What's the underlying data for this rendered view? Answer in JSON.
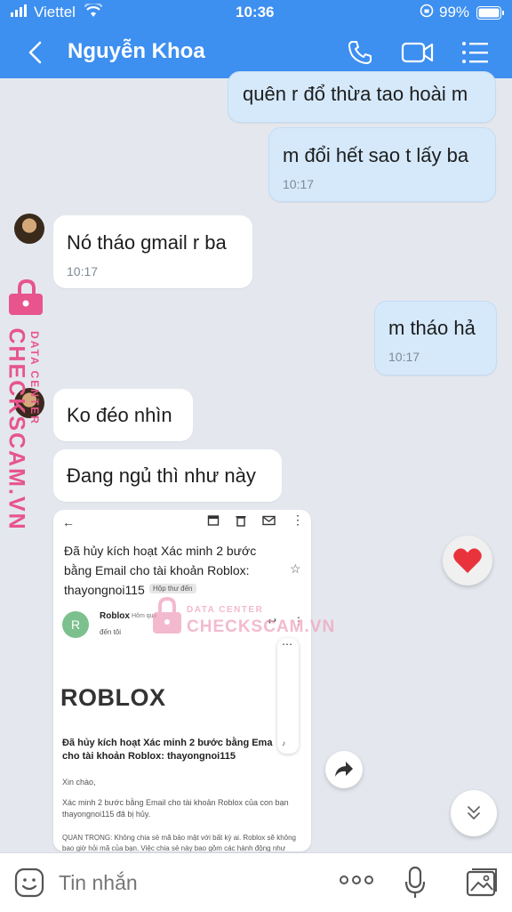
{
  "status_bar": {
    "carrier": "Viettel",
    "time": "10:36",
    "battery": "99%"
  },
  "header": {
    "contact_name": "Nguyễn Khoa"
  },
  "messages": [
    {
      "side": "me",
      "text": "quên r đổ thừa tao hoài m"
    },
    {
      "side": "me",
      "text": "m đổi hết sao t lấy ba",
      "time": "10:17"
    },
    {
      "side": "them",
      "text": "Nó tháo gmail r ba",
      "time": "10:17"
    },
    {
      "side": "me",
      "text": "m tháo hả",
      "time": "10:17"
    },
    {
      "side": "them",
      "text": "Ko đéo nhìn"
    },
    {
      "side": "them",
      "text": "Đang ngủ thì như này"
    }
  ],
  "email": {
    "subject": "Đã hủy kích hoạt Xác minh 2 bước bằng Email cho tài khoản Roblox: thayongnoi115",
    "subject_line1": "Đã hủy kích hoạt Xác minh 2 bước",
    "subject_line2": "bằng Email cho tài khoản Roblox:",
    "subject_line3": "thayongnoi115",
    "label": "Hộp thư đến",
    "sender": "Roblox",
    "sender_initial": "R",
    "date": "Hôm qua",
    "to": "đến tôi",
    "logo": "ROBLOX",
    "heading_line1": "Đã hủy kích hoạt Xác minh 2 bước bằng Ema",
    "heading_line2": "cho tài khoản Roblox: thayongnoi115",
    "greeting": "Xin chào,",
    "body_line1": "Xác minh 2 bước bằng Email cho tài khoản Roblox của con bạn",
    "body_line2": "thayongnoi115 đã bị hủy.",
    "important_line1": "QUAN TRỌNG: Không chia sẻ mã bảo mật với bất kỳ ai. Roblox sẽ không",
    "important_line2": "bao giờ hỏi mã của bạn. Việc chia sẻ này bao gồm các hành động như"
  },
  "watermark": {
    "top": "DATA CENTER",
    "bottom": "CHECKSCAM.VN"
  },
  "input": {
    "placeholder": "Tin nhắn"
  },
  "colors": {
    "header": "#3d8ff0",
    "sent_bubble": "#d5e9fb",
    "watermark": "#e7558c"
  }
}
